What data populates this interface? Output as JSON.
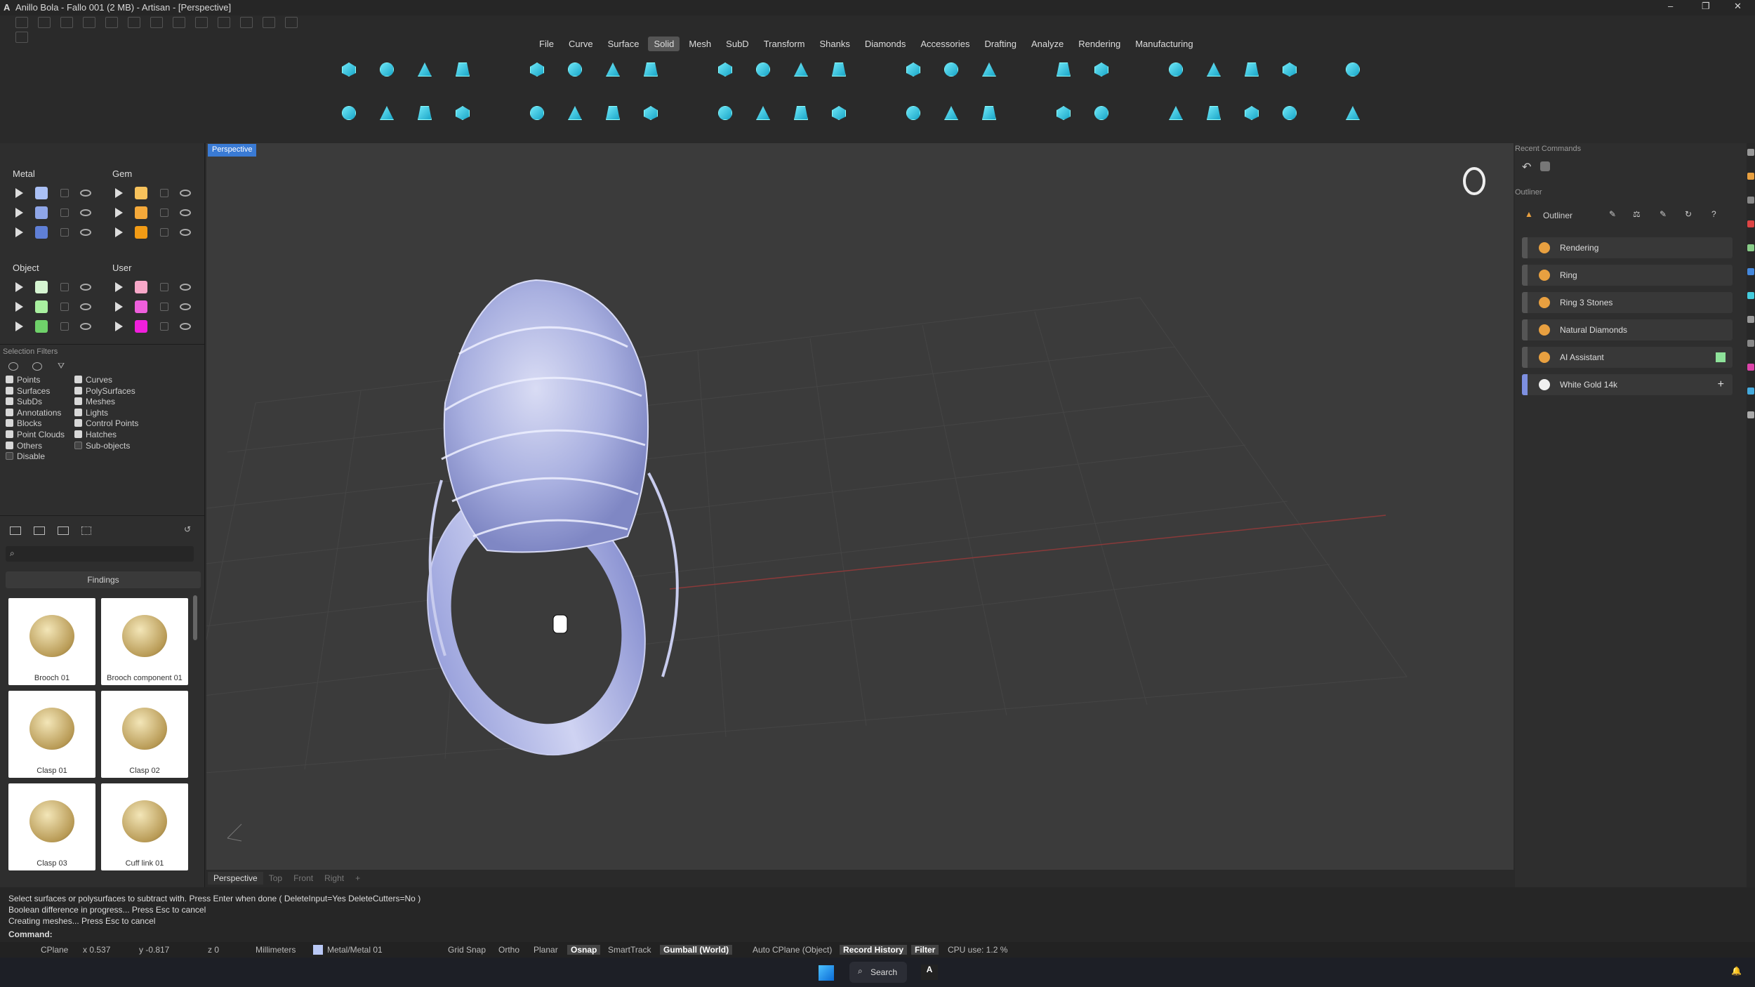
{
  "window": {
    "title": "Anillo Bola - Fallo 001 (2 MB) - Artisan - [Perspective]"
  },
  "menu": [
    "File",
    "Curve",
    "Surface",
    "Solid",
    "Mesh",
    "SubD",
    "Transform",
    "Shanks",
    "Diamonds",
    "Accessories",
    "Drafting",
    "Analyze",
    "Rendering",
    "Manufacturing"
  ],
  "menu_active": "Solid",
  "layers": {
    "metal": "Metal",
    "gem": "Gem",
    "object": "Object",
    "user": "User",
    "metal_colors": [
      "#aac0f5",
      "#8fa6e8",
      "#5f7fd6"
    ],
    "gem_colors": [
      "#f7c25c",
      "#f5a93a",
      "#f29b15"
    ],
    "object_colors": [
      "#d6f5d2",
      "#a9f0a0",
      "#6fd16a"
    ],
    "user_colors": [
      "#f7a8c8",
      "#ee5fdc",
      "#f01fdc"
    ]
  },
  "selection_filters": {
    "title": "Selection Filters",
    "col1": [
      {
        "label": "Points",
        "on": true
      },
      {
        "label": "Surfaces",
        "on": true
      },
      {
        "label": "SubDs",
        "on": true
      },
      {
        "label": "Annotations",
        "on": true
      },
      {
        "label": "Blocks",
        "on": true
      },
      {
        "label": "Point Clouds",
        "on": true
      },
      {
        "label": "Others",
        "on": true
      },
      {
        "label": "Disable",
        "on": false
      }
    ],
    "col2": [
      {
        "label": "Curves",
        "on": true
      },
      {
        "label": "PolySurfaces",
        "on": true
      },
      {
        "label": "Meshes",
        "on": true
      },
      {
        "label": "Lights",
        "on": true
      },
      {
        "label": "Control Points",
        "on": true
      },
      {
        "label": "Hatches",
        "on": true
      },
      {
        "label": "Sub-objects",
        "on": false
      }
    ]
  },
  "library": {
    "category": "Findings",
    "items": [
      "Brooch 01",
      "Brooch component 01",
      "Clasp 01",
      "Clasp 02",
      "Clasp 03",
      "Cuff link 01"
    ]
  },
  "viewport": {
    "active_tab": "Perspective",
    "tabs": [
      "Perspective",
      "Top",
      "Front",
      "Right",
      "+"
    ]
  },
  "right": {
    "recent": "Recent Commands",
    "outliner": "Outliner",
    "outliner_tab": "Outliner",
    "items": [
      {
        "label": "Rendering",
        "color": "#e8a040"
      },
      {
        "label": "Ring",
        "color": "#e8a040"
      },
      {
        "label": "Ring 3 Stones",
        "color": "#e8a040"
      },
      {
        "label": "Natural Diamonds",
        "color": "#e8a040"
      },
      {
        "label": "AI Assistant",
        "color": "#e8a040"
      },
      {
        "label": "White Gold 14k",
        "color": "#f0f0f0"
      }
    ]
  },
  "command": {
    "lines": [
      "Select surfaces or polysurfaces to subtract with. Press Enter when done ( DeleteInput=Yes  DeleteCutters=No )",
      "Boolean difference in progress... Press Esc to cancel",
      "Creating meshes... Press Esc to cancel"
    ],
    "prompt": "Command:"
  },
  "status": {
    "cplane": "CPlane",
    "x": "x 0.537",
    "y": "y -0.817",
    "z": "z 0",
    "units": "Millimeters",
    "layer": "Metal/Metal 01",
    "grid": "Grid Snap",
    "ortho": "Ortho",
    "planar": "Planar",
    "osnap": "Osnap",
    "smart": "SmartTrack",
    "gumball": "Gumball (World)",
    "autocp": "Auto CPlane (Object)",
    "record": "Record History",
    "filter": "Filter",
    "cpu": "CPU use: 1.2 %"
  },
  "taskbar": {
    "search": "Search"
  }
}
